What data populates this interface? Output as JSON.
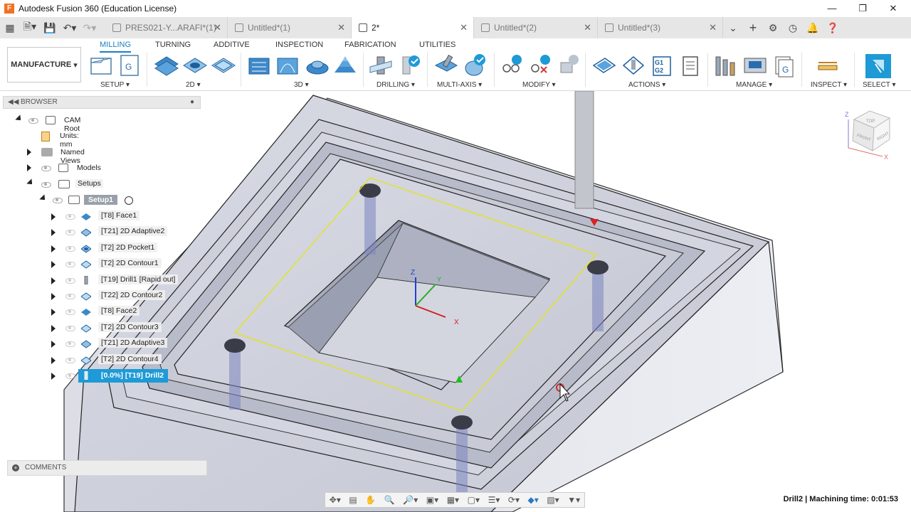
{
  "app": {
    "title": "Autodesk Fusion 360 (Education License)"
  },
  "doc_tabs": [
    {
      "label": "PRES021-Y...ARAFI*(1)",
      "active": false
    },
    {
      "label": "Untitled*(1)",
      "active": false
    },
    {
      "label": "2*",
      "active": true
    },
    {
      "label": "Untitled*(2)",
      "active": false
    },
    {
      "label": "Untitled*(3)",
      "active": false
    }
  ],
  "ribbon": {
    "workspace": "MANUFACTURE",
    "tabs": [
      "MILLING",
      "TURNING",
      "ADDITIVE",
      "INSPECTION",
      "FABRICATION",
      "UTILITIES"
    ],
    "groups": [
      "SETUP",
      "2D",
      "3D",
      "DRILLING",
      "MULTI-AXIS",
      "MODIFY",
      "ACTIONS",
      "MANAGE",
      "INSPECT",
      "SELECT"
    ]
  },
  "browser": {
    "header": "BROWSER",
    "cam_root": "CAM Root",
    "units": "Units: mm",
    "named_views": "Named Views",
    "models": "Models",
    "setups": "Setups",
    "setup1": "Setup1",
    "operations": [
      "[T8] Face1",
      "[T21] 2D Adaptive2",
      "[T2] 2D Pocket1",
      "[T2] 2D Contour1",
      "[T19] Drill1 [Rapid out]",
      "[T22] 2D Contour2",
      "[T8] Face2",
      "[T2] 2D Contour3",
      "[T21] 2D Adaptive3",
      "[T2] 2D Contour4",
      "[0.0%] [T19] Drill2"
    ]
  },
  "comments": "COMMENTS",
  "viewcube": {
    "top": "TOP",
    "front": "FRONT",
    "right": "RIGHT"
  },
  "axes": {
    "x": "X",
    "y": "Y",
    "z": "Z"
  },
  "status": {
    "op": "Drill2",
    "label": "Machining time: 0:01:53"
  },
  "colors": {
    "accent": "#1a7fc4",
    "selected": "#1e9ad6",
    "part": "#c9cbd6",
    "path": "#e6e600"
  }
}
